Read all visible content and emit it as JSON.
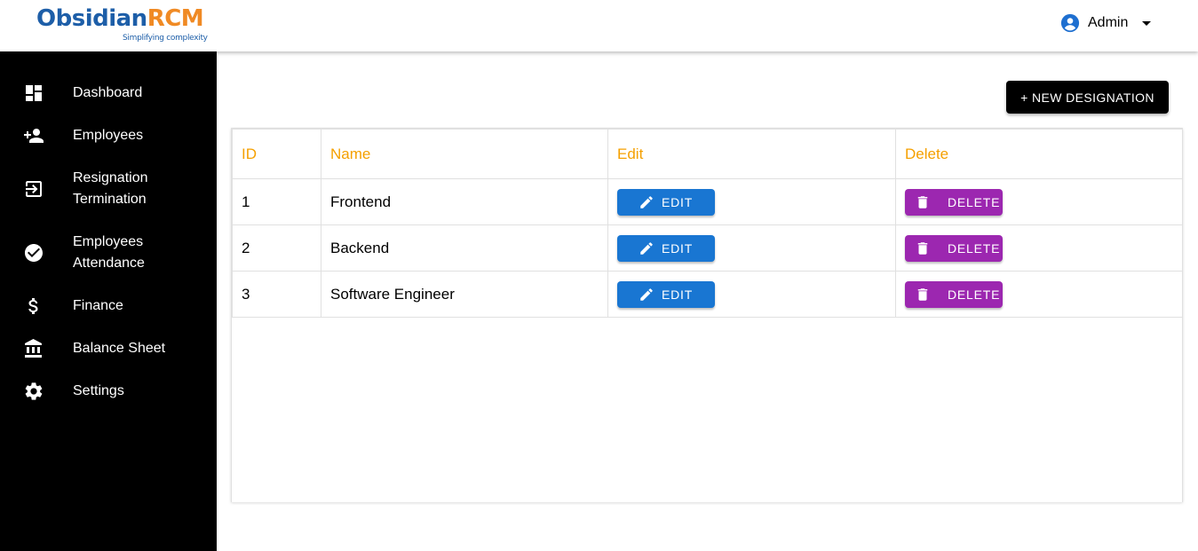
{
  "brand": {
    "name_part1": "Obsidian",
    "name_part2": "RCM",
    "tagline": "Simplifying complexity",
    "primary_color": "#1d5ea8",
    "accent_color": "#f08a24"
  },
  "header": {
    "user_name": "Admin",
    "user_icon": "account-circle-icon",
    "menu_icon": "caret-down-icon"
  },
  "sidebar": {
    "items": [
      {
        "label": "Dashboard",
        "icon": "dashboard-icon"
      },
      {
        "label": "Employees",
        "icon": "person-add-icon"
      },
      {
        "label": "Resignation\nTermination",
        "icon": "exit-icon"
      },
      {
        "label": "Employees\nAttendance",
        "icon": "check-circle-icon"
      },
      {
        "label": "Finance",
        "icon": "dollar-icon"
      },
      {
        "label": "Balance Sheet",
        "icon": "bank-icon"
      },
      {
        "label": "Settings",
        "icon": "gear-icon"
      }
    ]
  },
  "main": {
    "new_button_label": "+ NEW DESIGNATION",
    "table": {
      "headers": {
        "id": "ID",
        "name": "Name",
        "edit": "Edit",
        "delete": "Delete"
      },
      "header_color": "#f5a000",
      "rows": [
        {
          "id": "1",
          "name": "Frontend",
          "edit_label": "EDIT",
          "delete_label": "DELETE"
        },
        {
          "id": "2",
          "name": "Backend",
          "edit_label": "EDIT",
          "delete_label": "DELETE"
        },
        {
          "id": "3",
          "name": "Software Engineer",
          "edit_label": "EDIT",
          "delete_label": "DELETE"
        }
      ],
      "edit_color": "#1976d2",
      "delete_color": "#9c27b0"
    }
  }
}
